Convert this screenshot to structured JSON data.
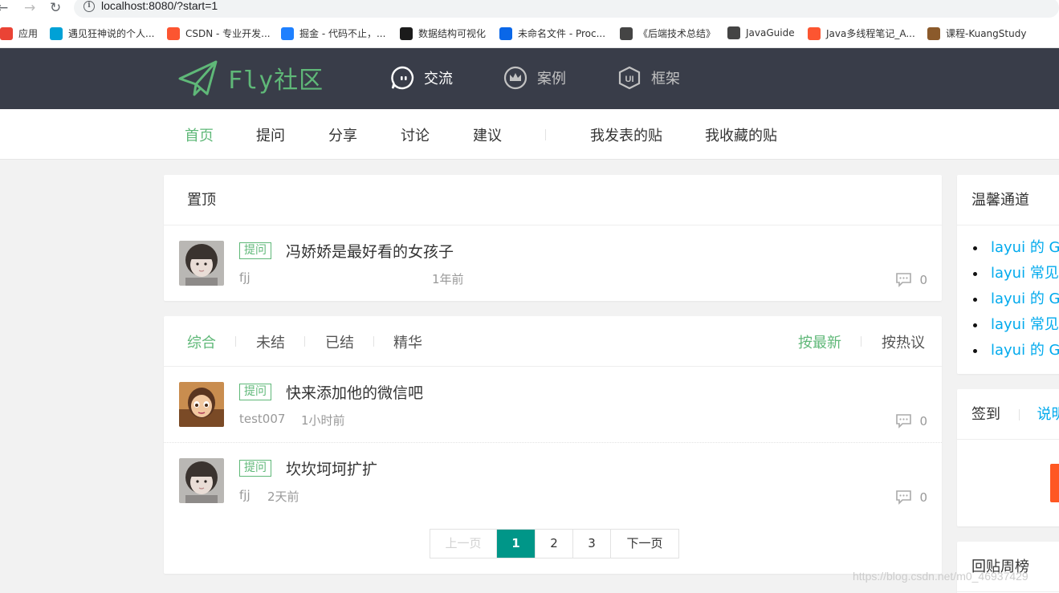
{
  "browser": {
    "url": "localhost:8080/?start=1",
    "bookmarks": [
      {
        "label": "应用",
        "icon": "apps-grid-icon",
        "color": "#ea4335"
      },
      {
        "label": "遇见狂神说的个人...",
        "icon": "bilibili-icon",
        "color": "#00a1d6"
      },
      {
        "label": "CSDN - 专业开发...",
        "icon": "csdn-icon",
        "color": "#fc5531"
      },
      {
        "label": "掘金 - 代码不止，...",
        "icon": "juejin-icon",
        "color": "#1e80ff"
      },
      {
        "label": "数据结构可视化",
        "icon": "usf-icon",
        "color": "#1b1b1b"
      },
      {
        "label": "未命名文件 - Proc...",
        "icon": "processon-icon",
        "color": "#0a67e8"
      },
      {
        "label": "《后端技术总结》",
        "icon": "globe-icon",
        "color": "#444"
      },
      {
        "label": "JavaGuide",
        "icon": "globe-icon",
        "color": "#444"
      },
      {
        "label": "Java多线程笔记_A...",
        "icon": "csdn-icon",
        "color": "#fc5531"
      },
      {
        "label": "课程-KuangStudy",
        "icon": "kuang-avatar-icon",
        "color": "#8b5a2b"
      }
    ]
  },
  "header": {
    "logo_text": "Fly社区",
    "nav": [
      {
        "label": "交流",
        "icon": "chat-bubble-icon",
        "active": true
      },
      {
        "label": "案例",
        "icon": "crown-icon",
        "active": false
      },
      {
        "label": "框架",
        "icon": "ui-shield-icon",
        "active": false
      }
    ]
  },
  "subnav": {
    "items": [
      "首页",
      "提问",
      "分享",
      "讨论",
      "建议"
    ],
    "user_items": [
      "我发表的贴",
      "我收藏的贴"
    ]
  },
  "pinned": {
    "title": "置顶",
    "posts": [
      {
        "badge": "提问",
        "title": "冯娇娇是最好看的女孩子",
        "user": "fjj",
        "time": "1年前",
        "comments": "0",
        "avatar": "girl"
      }
    ]
  },
  "list": {
    "filters": [
      "综合",
      "未结",
      "已结",
      "精华"
    ],
    "sorts": [
      "按最新",
      "按热议"
    ],
    "posts": [
      {
        "badge": "提问",
        "title": "快来添加他的微信吧",
        "user": "test007",
        "time": "1小时前",
        "comments": "0",
        "avatar": "cartoon"
      },
      {
        "badge": "提问",
        "title": "坎坎坷坷扩扩",
        "user": "fjj",
        "time": "2天前",
        "comments": "0",
        "avatar": "girl"
      }
    ],
    "pager": {
      "prev": "上一页",
      "pages": [
        "1",
        "2",
        "3"
      ],
      "current": "1",
      "next": "下一页"
    }
  },
  "sidebar": {
    "links_title": "温馨通道",
    "links": [
      "layui 的 GitHub",
      "layui 常见问题",
      "layui 的 GitHub",
      "layui 常见问题",
      "layui 的 GitHub"
    ],
    "sign_title": "签到",
    "sign_help": "说明",
    "reply_title": "回贴周榜"
  },
  "watermark": "https://blog.csdn.net/m0_46937429",
  "colors": {
    "accent": "#5fb878",
    "header_bg": "#393d49",
    "pager_current": "#009688",
    "link": "#01aaed",
    "sign_btn": "#ff5722"
  }
}
